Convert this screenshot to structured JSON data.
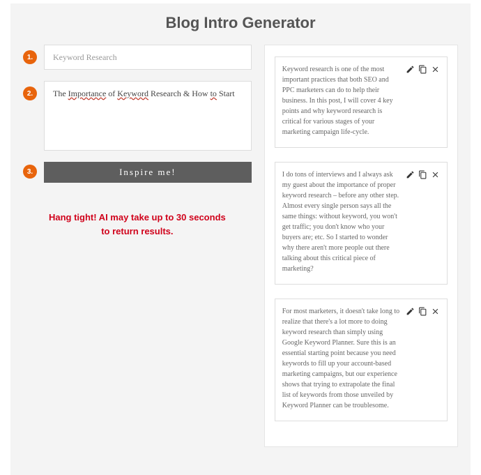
{
  "title": "Blog Intro Generator",
  "steps": {
    "one": {
      "num": "1.",
      "value": "Keyword Research"
    },
    "two": {
      "num": "2.",
      "value_parts": [
        "The ",
        "Importance",
        " of ",
        "Keyword",
        " Research & How ",
        "to",
        " Start"
      ]
    },
    "three": {
      "num": "3.",
      "label": "Inspire me!"
    }
  },
  "message_l1": "Hang tight! AI may take up to 30 seconds",
  "message_l2": "to return results.",
  "results": [
    {
      "text": "Keyword research is one of the most important practices that both SEO and PPC marketers can do to help their business. In this post, I will cover 4 key points and why keyword research is critical for various stages of your marketing campaign life-cycle."
    },
    {
      "text": "I do tons of interviews and I always ask my guest about the importance of proper keyword research – before any other step. Almost every single person says all the same things: without keyword, you won't get traffic; you don't know who your buyers are; etc. So I started to wonder why there aren't more people out there talking about this critical piece of marketing?"
    },
    {
      "text": "For most marketers, it doesn't take long to realize that there's a lot more to doing keyword research than simply using Google Keyword Planner. Sure this is an essential starting point because you need keywords to fill up your account-based marketing campaigns, but our experience shows that trying to extrapolate the final list of keywords from those unveiled by Keyword Planner can be troublesome."
    }
  ],
  "icons": {
    "edit": "edit-icon",
    "copy": "copy-icon",
    "close": "close-icon"
  }
}
